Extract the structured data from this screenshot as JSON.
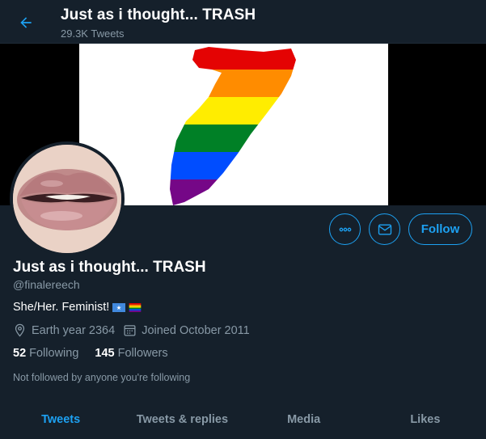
{
  "header": {
    "title": "Just as i thought... TRASH",
    "tweet_count": "29.3K Tweets",
    "back_icon": "arrow-left-icon"
  },
  "colors": {
    "accent": "#1da1f2",
    "background": "#15202b",
    "muted": "#8899a6"
  },
  "profile": {
    "name": "Just as i thought... TRASH",
    "handle": "@finalereech",
    "bio": "She/Her. Feminist!",
    "bio_flags": [
      "somalia-flag-icon",
      "rainbow-flag-icon"
    ],
    "location": "Earth year 2364",
    "joined": "Joined October 2011",
    "following_count": "52",
    "following_label": "Following",
    "followers_count": "145",
    "followers_label": "Followers",
    "not_followed_note": "Not followed by anyone you're following"
  },
  "actions": {
    "more_icon": "more-options-icon",
    "message_icon": "envelope-icon",
    "follow_label": "Follow"
  },
  "tabs": [
    {
      "label": "Tweets",
      "active": true
    },
    {
      "label": "Tweets & replies",
      "active": false
    },
    {
      "label": "Media",
      "active": false
    },
    {
      "label": "Likes",
      "active": false
    }
  ]
}
